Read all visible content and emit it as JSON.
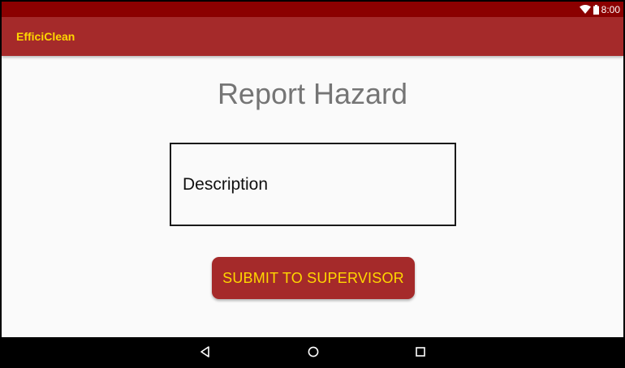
{
  "status_bar": {
    "time": "8:00",
    "icons": [
      "wifi-icon",
      "battery-icon"
    ],
    "background": "#8b0000"
  },
  "app_bar": {
    "title": "EfficiClean",
    "background": "#a52a2a",
    "title_color": "#ffd700"
  },
  "main": {
    "page_title": "Report Hazard",
    "description_field": {
      "placeholder": "Description",
      "value": ""
    },
    "submit_button": {
      "label": "SUBMIT TO SUPERVISOR",
      "background": "#a52a2a",
      "text_color": "#ffd700"
    }
  },
  "nav_bar": {
    "buttons": [
      "back-icon",
      "home-icon",
      "recents-icon"
    ]
  }
}
